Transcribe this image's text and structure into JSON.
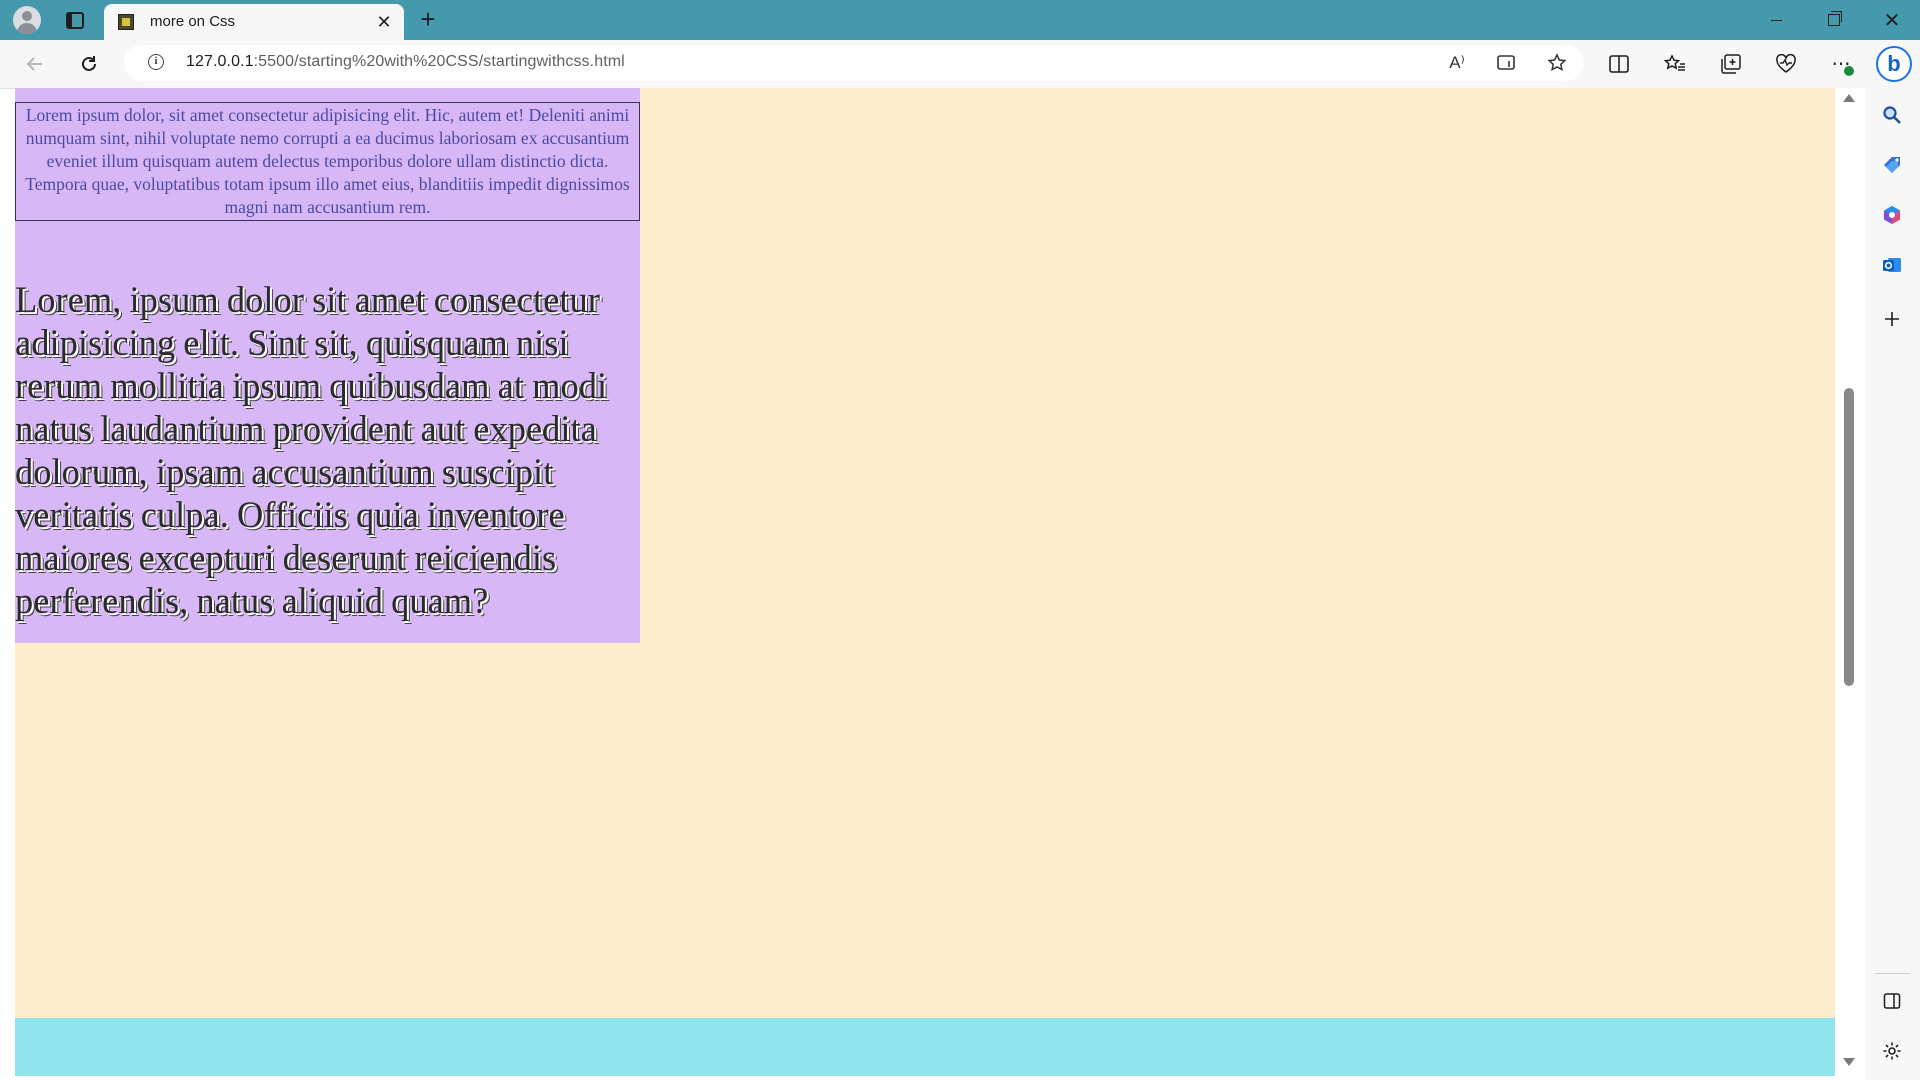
{
  "browser": {
    "tab_title": "more on Css",
    "tab_close": "✕",
    "new_tab": "+",
    "close_window": "✕",
    "url_host": "127.0.0.1",
    "url_rest": ":5500/starting%20with%20CSS/startingwithcss.html",
    "read_aloud": "A⁾",
    "more_tools": "⋯",
    "bing_label": "b"
  },
  "page": {
    "small_paragraph": "Lorem ipsum dolor, sit amet consectetur adipisicing elit. Hic, autem et! Deleniti animi numquam sint, nihil voluptate nemo corrupti a ea ducimus laboriosam ex accusantium eveniet illum quisquam autem delectus temporibus dolore ullam distinctio dicta. Tempora quae, voluptatibus totam ipsum illo amet eius, blanditiis impedit dignissimos magni nam accusantium rem.",
    "big_paragraph": "Lorem, ipsum dolor sit amet consectetur adipisicing elit. Sint sit, quisquam nisi rerum mollitia ipsum quibusdam at modi natus laudantium provident aut expedita dolorum, ipsam accusantium suscipit veritatis culpa. Officiis quia inventore maiores excepturi deserunt reiciendis perferendis, natus aliquid quam?"
  },
  "colors": {
    "titlebar": "#4499ad",
    "page_background": "#ffebcd",
    "column_background": "#d8b7f7",
    "small_text": "#4a4aa5",
    "footer_band": "#8de4ec"
  },
  "icons": {
    "profile": "profile-icon",
    "tabs": "tab-actions-icon",
    "back": "back-arrow-icon",
    "reload": "refresh-icon",
    "info": "site-info-icon",
    "read_aloud": "read-aloud-icon",
    "immersive": "immersive-reader-icon",
    "favorite": "star-icon",
    "split": "split-screen-icon",
    "favorites": "favorites-icon",
    "collections": "collections-icon",
    "performance": "heart-pulse-icon",
    "more": "more-icon",
    "copilot": "bing-icon",
    "sidebar": [
      "search-icon",
      "shopping-tag-icon",
      "office-icon",
      "outlook-icon",
      "add-icon",
      "hide-sidebar-icon",
      "settings-icon"
    ]
  }
}
